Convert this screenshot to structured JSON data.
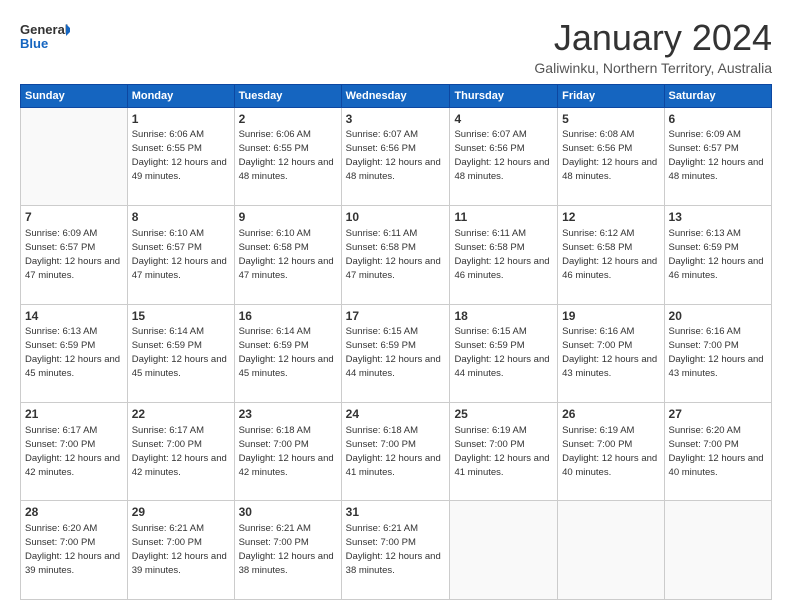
{
  "header": {
    "logo_line1": "General",
    "logo_line2": "Blue",
    "month": "January 2024",
    "location": "Galiwinku, Northern Territory, Australia"
  },
  "weekdays": [
    "Sunday",
    "Monday",
    "Tuesday",
    "Wednesday",
    "Thursday",
    "Friday",
    "Saturday"
  ],
  "weeks": [
    [
      {
        "day": "",
        "sunrise": "",
        "sunset": "",
        "daylight": ""
      },
      {
        "day": "1",
        "sunrise": "Sunrise: 6:06 AM",
        "sunset": "Sunset: 6:55 PM",
        "daylight": "Daylight: 12 hours and 49 minutes."
      },
      {
        "day": "2",
        "sunrise": "Sunrise: 6:06 AM",
        "sunset": "Sunset: 6:55 PM",
        "daylight": "Daylight: 12 hours and 48 minutes."
      },
      {
        "day": "3",
        "sunrise": "Sunrise: 6:07 AM",
        "sunset": "Sunset: 6:56 PM",
        "daylight": "Daylight: 12 hours and 48 minutes."
      },
      {
        "day": "4",
        "sunrise": "Sunrise: 6:07 AM",
        "sunset": "Sunset: 6:56 PM",
        "daylight": "Daylight: 12 hours and 48 minutes."
      },
      {
        "day": "5",
        "sunrise": "Sunrise: 6:08 AM",
        "sunset": "Sunset: 6:56 PM",
        "daylight": "Daylight: 12 hours and 48 minutes."
      },
      {
        "day": "6",
        "sunrise": "Sunrise: 6:09 AM",
        "sunset": "Sunset: 6:57 PM",
        "daylight": "Daylight: 12 hours and 48 minutes."
      }
    ],
    [
      {
        "day": "7",
        "sunrise": "Sunrise: 6:09 AM",
        "sunset": "Sunset: 6:57 PM",
        "daylight": "Daylight: 12 hours and 47 minutes."
      },
      {
        "day": "8",
        "sunrise": "Sunrise: 6:10 AM",
        "sunset": "Sunset: 6:57 PM",
        "daylight": "Daylight: 12 hours and 47 minutes."
      },
      {
        "day": "9",
        "sunrise": "Sunrise: 6:10 AM",
        "sunset": "Sunset: 6:58 PM",
        "daylight": "Daylight: 12 hours and 47 minutes."
      },
      {
        "day": "10",
        "sunrise": "Sunrise: 6:11 AM",
        "sunset": "Sunset: 6:58 PM",
        "daylight": "Daylight: 12 hours and 47 minutes."
      },
      {
        "day": "11",
        "sunrise": "Sunrise: 6:11 AM",
        "sunset": "Sunset: 6:58 PM",
        "daylight": "Daylight: 12 hours and 46 minutes."
      },
      {
        "day": "12",
        "sunrise": "Sunrise: 6:12 AM",
        "sunset": "Sunset: 6:58 PM",
        "daylight": "Daylight: 12 hours and 46 minutes."
      },
      {
        "day": "13",
        "sunrise": "Sunrise: 6:13 AM",
        "sunset": "Sunset: 6:59 PM",
        "daylight": "Daylight: 12 hours and 46 minutes."
      }
    ],
    [
      {
        "day": "14",
        "sunrise": "Sunrise: 6:13 AM",
        "sunset": "Sunset: 6:59 PM",
        "daylight": "Daylight: 12 hours and 45 minutes."
      },
      {
        "day": "15",
        "sunrise": "Sunrise: 6:14 AM",
        "sunset": "Sunset: 6:59 PM",
        "daylight": "Daylight: 12 hours and 45 minutes."
      },
      {
        "day": "16",
        "sunrise": "Sunrise: 6:14 AM",
        "sunset": "Sunset: 6:59 PM",
        "daylight": "Daylight: 12 hours and 45 minutes."
      },
      {
        "day": "17",
        "sunrise": "Sunrise: 6:15 AM",
        "sunset": "Sunset: 6:59 PM",
        "daylight": "Daylight: 12 hours and 44 minutes."
      },
      {
        "day": "18",
        "sunrise": "Sunrise: 6:15 AM",
        "sunset": "Sunset: 6:59 PM",
        "daylight": "Daylight: 12 hours and 44 minutes."
      },
      {
        "day": "19",
        "sunrise": "Sunrise: 6:16 AM",
        "sunset": "Sunset: 7:00 PM",
        "daylight": "Daylight: 12 hours and 43 minutes."
      },
      {
        "day": "20",
        "sunrise": "Sunrise: 6:16 AM",
        "sunset": "Sunset: 7:00 PM",
        "daylight": "Daylight: 12 hours and 43 minutes."
      }
    ],
    [
      {
        "day": "21",
        "sunrise": "Sunrise: 6:17 AM",
        "sunset": "Sunset: 7:00 PM",
        "daylight": "Daylight: 12 hours and 42 minutes."
      },
      {
        "day": "22",
        "sunrise": "Sunrise: 6:17 AM",
        "sunset": "Sunset: 7:00 PM",
        "daylight": "Daylight: 12 hours and 42 minutes."
      },
      {
        "day": "23",
        "sunrise": "Sunrise: 6:18 AM",
        "sunset": "Sunset: 7:00 PM",
        "daylight": "Daylight: 12 hours and 42 minutes."
      },
      {
        "day": "24",
        "sunrise": "Sunrise: 6:18 AM",
        "sunset": "Sunset: 7:00 PM",
        "daylight": "Daylight: 12 hours and 41 minutes."
      },
      {
        "day": "25",
        "sunrise": "Sunrise: 6:19 AM",
        "sunset": "Sunset: 7:00 PM",
        "daylight": "Daylight: 12 hours and 41 minutes."
      },
      {
        "day": "26",
        "sunrise": "Sunrise: 6:19 AM",
        "sunset": "Sunset: 7:00 PM",
        "daylight": "Daylight: 12 hours and 40 minutes."
      },
      {
        "day": "27",
        "sunrise": "Sunrise: 6:20 AM",
        "sunset": "Sunset: 7:00 PM",
        "daylight": "Daylight: 12 hours and 40 minutes."
      }
    ],
    [
      {
        "day": "28",
        "sunrise": "Sunrise: 6:20 AM",
        "sunset": "Sunset: 7:00 PM",
        "daylight": "Daylight: 12 hours and 39 minutes."
      },
      {
        "day": "29",
        "sunrise": "Sunrise: 6:21 AM",
        "sunset": "Sunset: 7:00 PM",
        "daylight": "Daylight: 12 hours and 39 minutes."
      },
      {
        "day": "30",
        "sunrise": "Sunrise: 6:21 AM",
        "sunset": "Sunset: 7:00 PM",
        "daylight": "Daylight: 12 hours and 38 minutes."
      },
      {
        "day": "31",
        "sunrise": "Sunrise: 6:21 AM",
        "sunset": "Sunset: 7:00 PM",
        "daylight": "Daylight: 12 hours and 38 minutes."
      },
      {
        "day": "",
        "sunrise": "",
        "sunset": "",
        "daylight": ""
      },
      {
        "day": "",
        "sunrise": "",
        "sunset": "",
        "daylight": ""
      },
      {
        "day": "",
        "sunrise": "",
        "sunset": "",
        "daylight": ""
      }
    ]
  ]
}
